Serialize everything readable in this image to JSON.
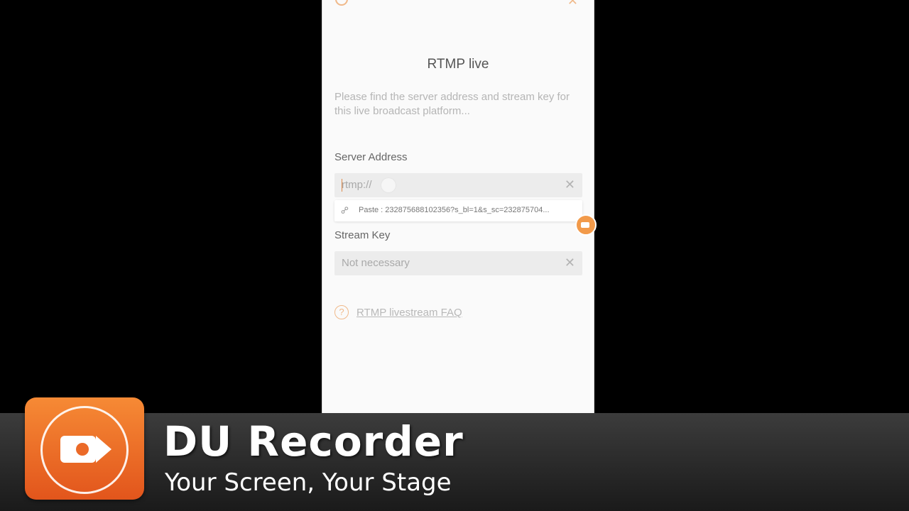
{
  "dialog": {
    "title": "RTMP live",
    "description": "Please find the server address and stream key for this live broadcast platform...",
    "server_label": "Server Address",
    "server_value": "rtmp://",
    "paste_suggestion": "Paste : 232875688102356?s_bl=1&s_sc=232875704...",
    "stream_key_label": "Stream Key",
    "stream_key_placeholder": "Not necessary",
    "faq_link": "RTMP livestream FAQ",
    "clear_glyph": "✕"
  },
  "branding": {
    "name": "DU Recorder",
    "tagline": "Your Screen, Your Stage",
    "accent_color": "#f0812f"
  },
  "icons": {
    "clear": "close-icon",
    "link": "link-icon",
    "help": "help-circle-icon",
    "logo": "video-camera-icon"
  }
}
